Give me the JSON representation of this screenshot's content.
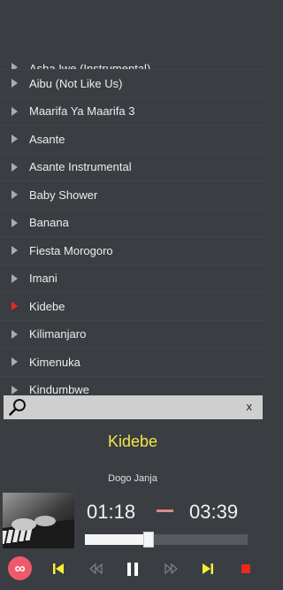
{
  "songs": [
    {
      "label": "Asha Iwe (Instrumental)"
    },
    {
      "label": "Aibu (Not Like Us)"
    },
    {
      "label": "Maarifa Ya Maarifa 3"
    },
    {
      "label": "Asante"
    },
    {
      "label": "Asante Instrumental"
    },
    {
      "label": "Baby Shower"
    },
    {
      "label": "Banana"
    },
    {
      "label": "Fiesta Morogoro"
    },
    {
      "label": "Imani"
    },
    {
      "label": "Kidebe"
    },
    {
      "label": "Kilimanjaro"
    },
    {
      "label": "Kimenuka"
    },
    {
      "label": "Kindumbwe"
    }
  ],
  "active_index": 9,
  "search": {
    "value": "",
    "placeholder": "",
    "clear_label": "x"
  },
  "now_playing": {
    "title": "Kidebe",
    "artist": "Dogo Janja",
    "current_time": "01:18",
    "total_time": "03:39",
    "progress": 0.36
  },
  "colors": {
    "background": "#3a3d42",
    "accent_title": "#f2e64b",
    "active_arrow": "#e8291c",
    "skip_buttons": "#f5f036",
    "stop_button": "#e8291c",
    "loop_button": "#ee5a6c"
  },
  "icons": {
    "search": "search-icon",
    "loop": "infinity-icon",
    "prev": "skip-previous-icon",
    "rewind": "rewind-icon",
    "play_pause": "pause-icon",
    "forward": "fast-forward-icon",
    "next": "skip-next-icon",
    "stop": "stop-icon"
  }
}
